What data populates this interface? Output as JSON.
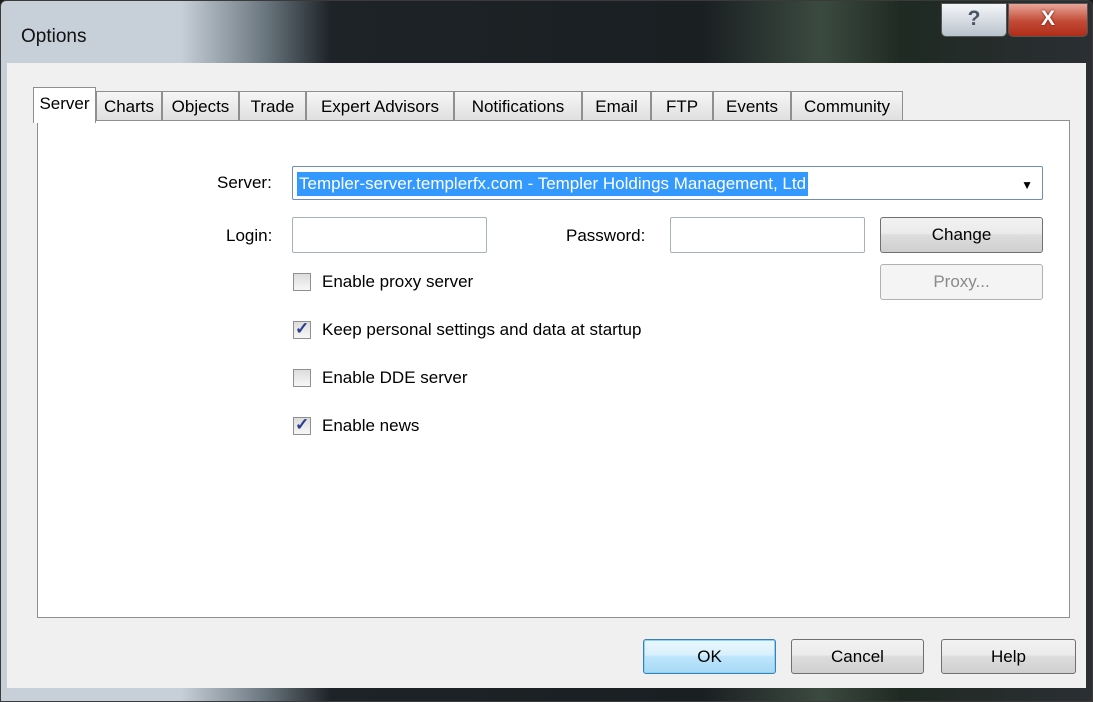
{
  "window": {
    "title": "Options",
    "help_glyph": "?",
    "close_glyph": "X"
  },
  "tabs": [
    {
      "label": "Server",
      "active": true
    },
    {
      "label": "Charts"
    },
    {
      "label": "Objects"
    },
    {
      "label": "Trade"
    },
    {
      "label": "Expert Advisors"
    },
    {
      "label": "Notifications"
    },
    {
      "label": "Email"
    },
    {
      "label": "FTP"
    },
    {
      "label": "Events"
    },
    {
      "label": "Community"
    }
  ],
  "server": {
    "server_label": "Server:",
    "server_value": "Templer-server.templerfx.com - Templer Holdings Management, Ltd",
    "login_label": "Login:",
    "login_value": "",
    "password_label": "Password:",
    "password_value": "",
    "change_label": "Change",
    "proxy_label": "Proxy...",
    "options": [
      {
        "label": "Enable proxy server",
        "checked": false
      },
      {
        "label": "Keep personal settings and data at startup",
        "checked": true
      },
      {
        "label": "Enable DDE server",
        "checked": false
      },
      {
        "label": "Enable news",
        "checked": true
      }
    ]
  },
  "footer": {
    "ok_label": "OK",
    "cancel_label": "Cancel",
    "help_label": "Help"
  }
}
